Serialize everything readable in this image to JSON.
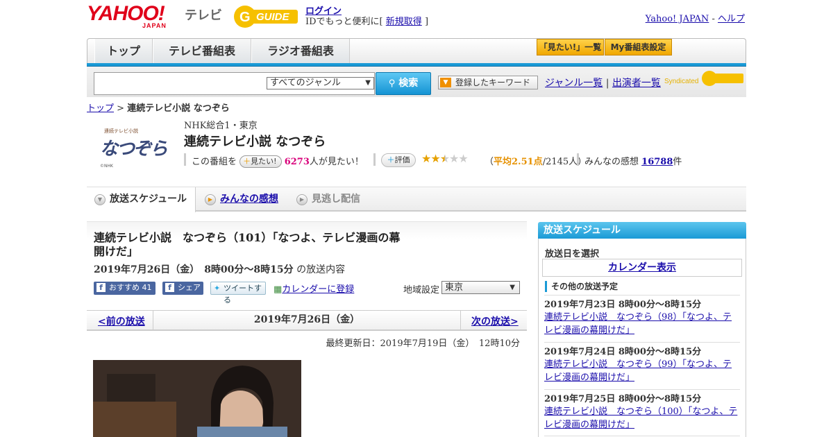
{
  "header": {
    "yahoo_logo": "YAHOO!",
    "yahoo_japan": "JAPAN",
    "tv_label": "テレビ",
    "gguide_logo": "GUIDE",
    "login": "ログイン",
    "login_note": "IDでもっと便利に[",
    "signup": "新規取得",
    "login_note_end": "]",
    "yahoo_japan_link": "Yahoo! JAPAN",
    "sep": "-",
    "help": "ヘルプ"
  },
  "nav": {
    "tabs": [
      "トップ",
      "テレビ番組表",
      "ラジオ番組表"
    ],
    "mitai_list": "「見たい!」一覧",
    "my_guide": "My番組表設定"
  },
  "search": {
    "genre": "すべてのジャンル",
    "button": "検索",
    "keyword_button": "登録したキーワード",
    "genre_list": "ジャンル一覧",
    "bar": "|",
    "performer_list": "出演者一覧",
    "syndicated": "Syndicated"
  },
  "breadcrumb": {
    "top": "トップ",
    "sep": ">",
    "current": "連続テレビ小説 なつぞら"
  },
  "program": {
    "logo_text": "なつぞら",
    "logo_small": "連続テレビ小説",
    "logo_copy": "©NHK",
    "channel": "NHK総合1・東京",
    "title": "連続テレビ小説 なつぞら",
    "want_prefix": "この番組を",
    "want_btn": "見たい!",
    "want_count": "6273",
    "want_suffix": "人が見たい！",
    "rate_btn": "評価",
    "stars_value": 2.51,
    "stars_filled": "★★",
    "stars_half": "★",
    "stars_empty": "★★",
    "avg_open": "（",
    "avg_label": "平均2.51点",
    "avg_count": "/2145人）",
    "kansou_label": "みんなの感想",
    "kansou_count": "16788",
    "kansou_unit": "件"
  },
  "tabs": {
    "schedule": "放送スケジュール",
    "kansou": "みんなの感想",
    "minogashi": "見逃し配信"
  },
  "episode": {
    "title": "連続テレビ小説　なつぞら（101）「なつよ、テレビ漫画の幕開けだ」",
    "date": "2019年7月26日（金）　8時00分～8時15分",
    "date_suffix": "の放送内容",
    "fb_recommend": "おすすめ",
    "fb_count": "41",
    "fb_share": "シェア",
    "tweet": "ツイートする",
    "calendar_register": "カレンダーに登録",
    "region_label": "地域設定",
    "region_value": "東京",
    "prev": "<前の放送",
    "pager_date": "2019年7月26日（金）",
    "next": "次の放送>",
    "updated": "最終更新日：2019年7月19日（金）　12時10分"
  },
  "sidebar": {
    "heading": "放送スケジュール",
    "pick_date": "放送日を選択",
    "calendar": "カレンダー表示",
    "other": "その他の放送予定",
    "items": [
      {
        "date": "2019年7月23日  8時00分～8時15分",
        "title": "連続テレビ小説　なつぞら（98）「なつよ、テレビ漫画の幕開けだ」"
      },
      {
        "date": "2019年7月24日  8時00分～8時15分",
        "title": "連続テレビ小説　なつぞら（99）「なつよ、テレビ漫画の幕開けだ」"
      },
      {
        "date": "2019年7月25日  8時00分～8時15分",
        "title": "連続テレビ小説　なつぞら（100）「なつよ、テレビ漫画の幕開けだ」"
      }
    ]
  }
}
